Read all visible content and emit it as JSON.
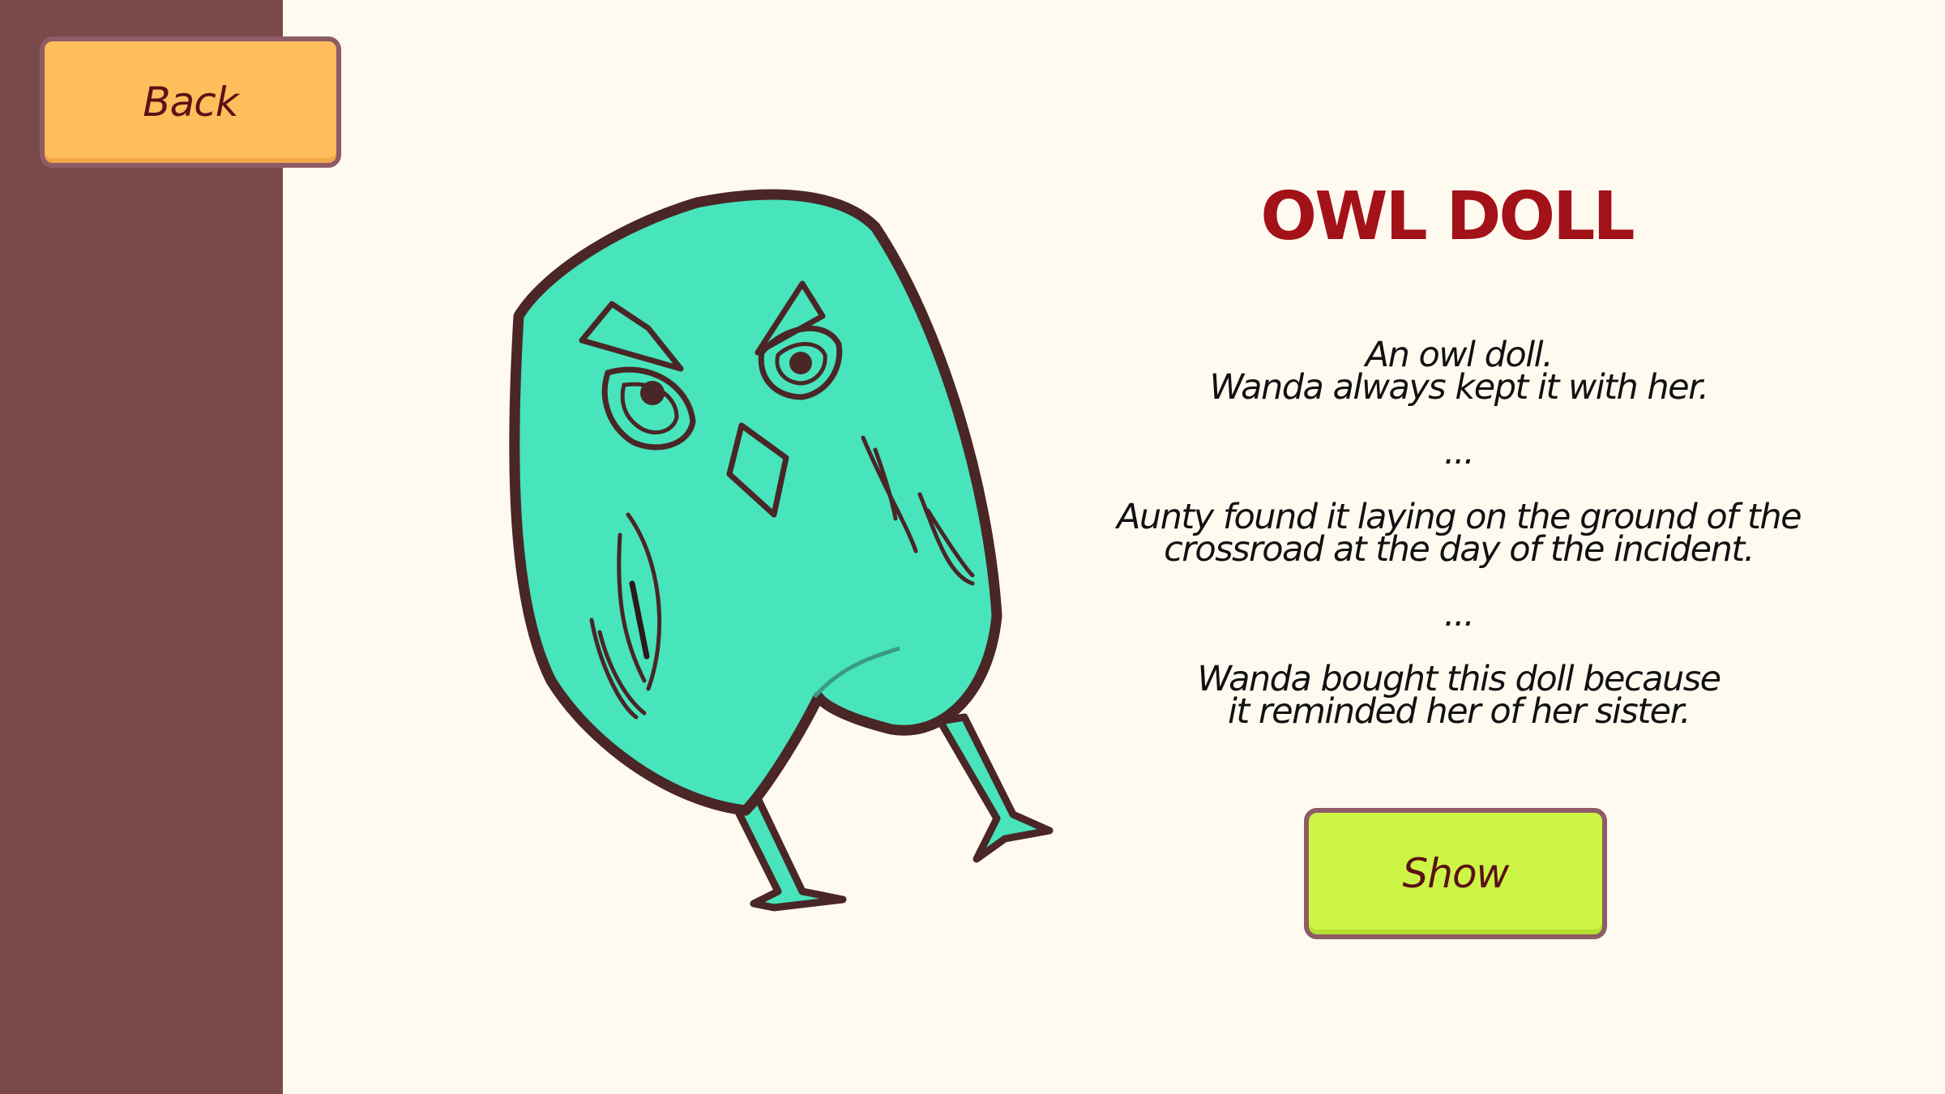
{
  "navigation": {
    "back_label": "Back"
  },
  "item": {
    "title": "OWL DOLL",
    "description_lines": [
      "An owl doll.",
      "Wanda always kept it with her.",
      "...",
      "Aunty found it laying on the ground of the",
      "crossroad at the day of the incident.",
      "...",
      "Wanda bought this doll because",
      "it reminded her of her sister."
    ],
    "illustration": "owl-doll-illustration"
  },
  "actions": {
    "show_label": "Show"
  },
  "colors": {
    "sidebar": "#7a4a4a",
    "background": "#fffaf0",
    "back_button": "#ffbd5c",
    "show_button": "#ccf545",
    "button_border": "#8e5c66",
    "title": "#a31218",
    "owl_body": "#48e4bb",
    "owl_outline": "#4a2626"
  }
}
